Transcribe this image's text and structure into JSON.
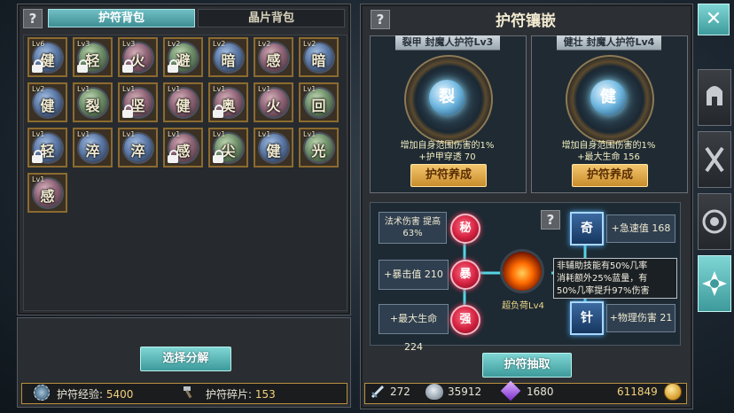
{
  "left_panel": {
    "help_icon": "?",
    "tabs": [
      {
        "label": "护符背包",
        "active": true
      },
      {
        "label": "晶片背包",
        "active": false
      }
    ],
    "slots": [
      {
        "lv": "Lv6",
        "ch": "健",
        "locked": true,
        "tone": "blue"
      },
      {
        "lv": "Lv3",
        "ch": "轻",
        "locked": true,
        "tone": "green"
      },
      {
        "lv": "Lv3",
        "ch": "火",
        "locked": true,
        "tone": "red"
      },
      {
        "lv": "Lv2",
        "ch": "避",
        "locked": true,
        "tone": "green"
      },
      {
        "lv": "Lv2",
        "ch": "暗",
        "locked": false,
        "tone": "blue"
      },
      {
        "lv": "Lv2",
        "ch": "感",
        "locked": false,
        "tone": "red"
      },
      {
        "lv": "Lv2",
        "ch": "暗",
        "locked": false,
        "tone": "blue"
      },
      {
        "lv": "Lv2",
        "ch": "健",
        "locked": false,
        "tone": "blue"
      },
      {
        "lv": "Lv1",
        "ch": "裂",
        "locked": false,
        "tone": "green"
      },
      {
        "lv": "Lv1",
        "ch": "坚",
        "locked": true,
        "tone": "red"
      },
      {
        "lv": "Lv1",
        "ch": "健",
        "locked": false,
        "tone": "red"
      },
      {
        "lv": "Lv1",
        "ch": "奥",
        "locked": true,
        "tone": "red"
      },
      {
        "lv": "Lv1",
        "ch": "火",
        "locked": false,
        "tone": "red"
      },
      {
        "lv": "Lv1",
        "ch": "回",
        "locked": false,
        "tone": "green"
      },
      {
        "lv": "Lv1",
        "ch": "轻",
        "locked": true,
        "tone": "blue"
      },
      {
        "lv": "Lv1",
        "ch": "淬",
        "locked": false,
        "tone": "blue"
      },
      {
        "lv": "Lv1",
        "ch": "淬",
        "locked": false,
        "tone": "blue"
      },
      {
        "lv": "Lv1",
        "ch": "感",
        "locked": true,
        "tone": "red"
      },
      {
        "lv": "Lv1",
        "ch": "尖",
        "locked": true,
        "tone": "green"
      },
      {
        "lv": "Lv1",
        "ch": "健",
        "locked": false,
        "tone": "blue"
      },
      {
        "lv": "Lv1",
        "ch": "光",
        "locked": false,
        "tone": "green"
      },
      {
        "lv": "Lv1",
        "ch": "感",
        "locked": false,
        "tone": "red"
      }
    ],
    "decompose_button": "选择分解",
    "exp_label": "护符经验:",
    "exp_value": "5400",
    "fragments_label": "护符碎片:",
    "fragments_value": "153"
  },
  "right_panel": {
    "help_icon": "?",
    "title": "护符镶嵌",
    "close_icon": "✕",
    "cards": [
      {
        "title": "裂甲 封魔人护符Lv3",
        "gem": "裂",
        "effect1": "增加自身范围伤害的1%",
        "effect2": "+护甲穿透 70",
        "button": "护符养成"
      },
      {
        "title": "健壮 封魔人护符Lv4",
        "gem": "健",
        "effect1": "增加自身范围伤害的1%",
        "effect2": "+最大生命 156",
        "button": "护符养成"
      }
    ],
    "tree": {
      "help_icon": "?",
      "left_attrs": [
        "法术伤害 提高 63%",
        "+暴击值 210",
        "+最大生命 224"
      ],
      "red_nodes": [
        "秘",
        "暴",
        "强"
      ],
      "center_label": "超负荷Lv4",
      "blue_nodes": [
        "奇",
        "针"
      ],
      "right_attrs": [
        "+急速值 168",
        "+物理伤害 21"
      ],
      "tooltip": [
        "非辅助技能有50%几率",
        "消耗额外25%蓝量，有",
        "50%几率提升97%伤害"
      ]
    },
    "extract_button": "护符抽取",
    "currencies": [
      "272",
      "35912",
      "1680",
      "611849"
    ]
  },
  "side_tabs": [
    "helmet-icon",
    "armor-icon",
    "shield-icon",
    "amulet-icon"
  ],
  "colors": {
    "accent_teal": "#4fa7ad",
    "gold": "#d9a24a",
    "frame_gold": "#b98f3d"
  }
}
